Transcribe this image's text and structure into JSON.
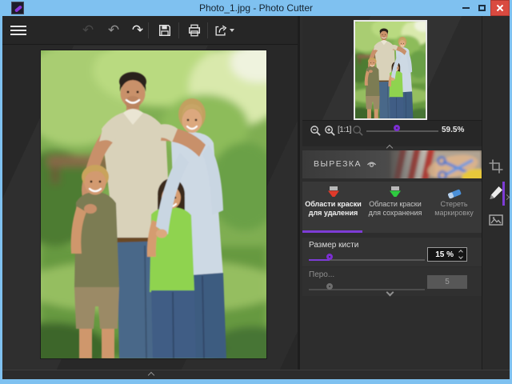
{
  "colors": {
    "accent_purple": "#7d3cd6",
    "titlebar_blue": "#7fc1f0",
    "close_red": "#d94a40",
    "marker_remove_red": "#e03a2a",
    "marker_keep_green": "#2ecc40",
    "eraser_blue": "#4a90d9"
  },
  "window": {
    "title": "Photo_1.jpg - Photo Cutter"
  },
  "toolbar": {
    "icons": [
      "menu-icon",
      "reset-icon",
      "undo-icon",
      "redo-icon",
      "save-icon",
      "print-icon",
      "share-icon"
    ],
    "reset_glyph": "↶",
    "undo_glyph": "↶",
    "redo_glyph": "↷"
  },
  "preview": {
    "actual_size_label": "[1:1]",
    "zoom_value": "59.5%"
  },
  "cutout": {
    "title": "ВЫРЕЗКА"
  },
  "tabs": [
    {
      "line1": "Области краски",
      "line2": "для удаления"
    },
    {
      "line1": "Области краски",
      "line2": "для сохранения"
    },
    {
      "line1": "Стереть маркировку",
      "line2": ""
    }
  ],
  "brush": {
    "label": "Размер кисти",
    "value": "15 %"
  },
  "feather": {
    "label": "Перо...",
    "value": "5"
  }
}
